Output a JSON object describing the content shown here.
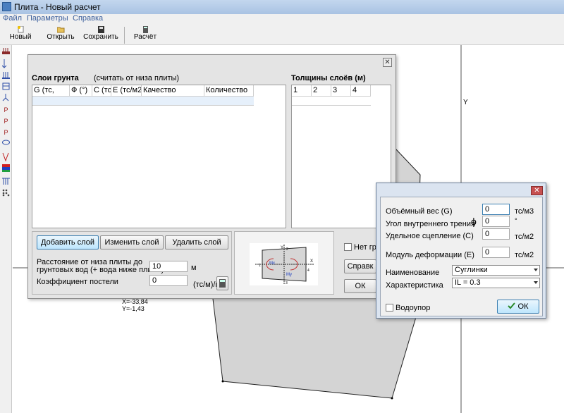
{
  "app": {
    "title": "Плита - Новый расчет"
  },
  "menu": [
    "Файл",
    "Параметры",
    "Справка"
  ],
  "toolbar": {
    "new": "Новый",
    "open": "Открыть",
    "save": "Сохранить",
    "calc": "Расчёт"
  },
  "left_tools": [
    "Р",
    "Р",
    "Р"
  ],
  "canvas": {
    "y_axis": "Y",
    "coords": {
      "x": "X=-33,84",
      "y": "Y=-1,43"
    },
    "fill": "#d4d4d4"
  },
  "dialog_soil": {
    "layers_title": "Слои грунта",
    "layers_hint": "(считать от низа плиты)",
    "columns": [
      "G (тс,",
      "Ф (°)",
      "С (тс,",
      "Е (тс/м2",
      "Качество",
      "Количество"
    ],
    "thickness_title": "Толщины слоёв (м)",
    "thickness_columns": [
      "1",
      "2",
      "3",
      "4"
    ],
    "btn_add": "Добавить слой",
    "btn_edit": "Изменить слой",
    "btn_delete": "Удалить слой",
    "groundwater_label_1": "Расстояние от низа плиты до",
    "groundwater_label_2": "грунтовых вод (+ вода ниже плиты)",
    "groundwater_value": "10",
    "groundwater_unit": "м",
    "bedding_label": "Коэффициент постели",
    "bedding_value": "0",
    "bedding_unit": "(тс/м)/м",
    "no_ground_label": "Нет гру",
    "btn_help": "Справк",
    "btn_ok": "ОК",
    "close_glyph": "✕",
    "diagram": {
      "y": "Y",
      "x": "X",
      "mx": "Mx",
      "my": "My",
      "n1": "1",
      "n2": "2",
      "n3": "3",
      "n4": "4"
    }
  },
  "dialog_layer": {
    "close_glyph": "✕",
    "weight_label": "Объёмный вес (G)",
    "weight_value": "0",
    "weight_unit": "тс/м3",
    "friction_label": "Угол внутреннего трения",
    "friction_symbol": "ϕ",
    "friction_value": "0",
    "friction_unit": "°",
    "cohesion_label": "Удельное сцепление (С)",
    "cohesion_value": "0",
    "cohesion_unit": "тс/м2",
    "modulus_label": "Модуль деформации (Е)",
    "modulus_value": "0",
    "modulus_unit": "тс/м2",
    "name_label": "Наименование",
    "name_value": "Суглинки",
    "char_label": "Характеристика",
    "char_value": "IL = 0.3",
    "waterproof_label": "Водоупор",
    "ok_label": "ОК",
    "accent": "#2a8a2a"
  }
}
